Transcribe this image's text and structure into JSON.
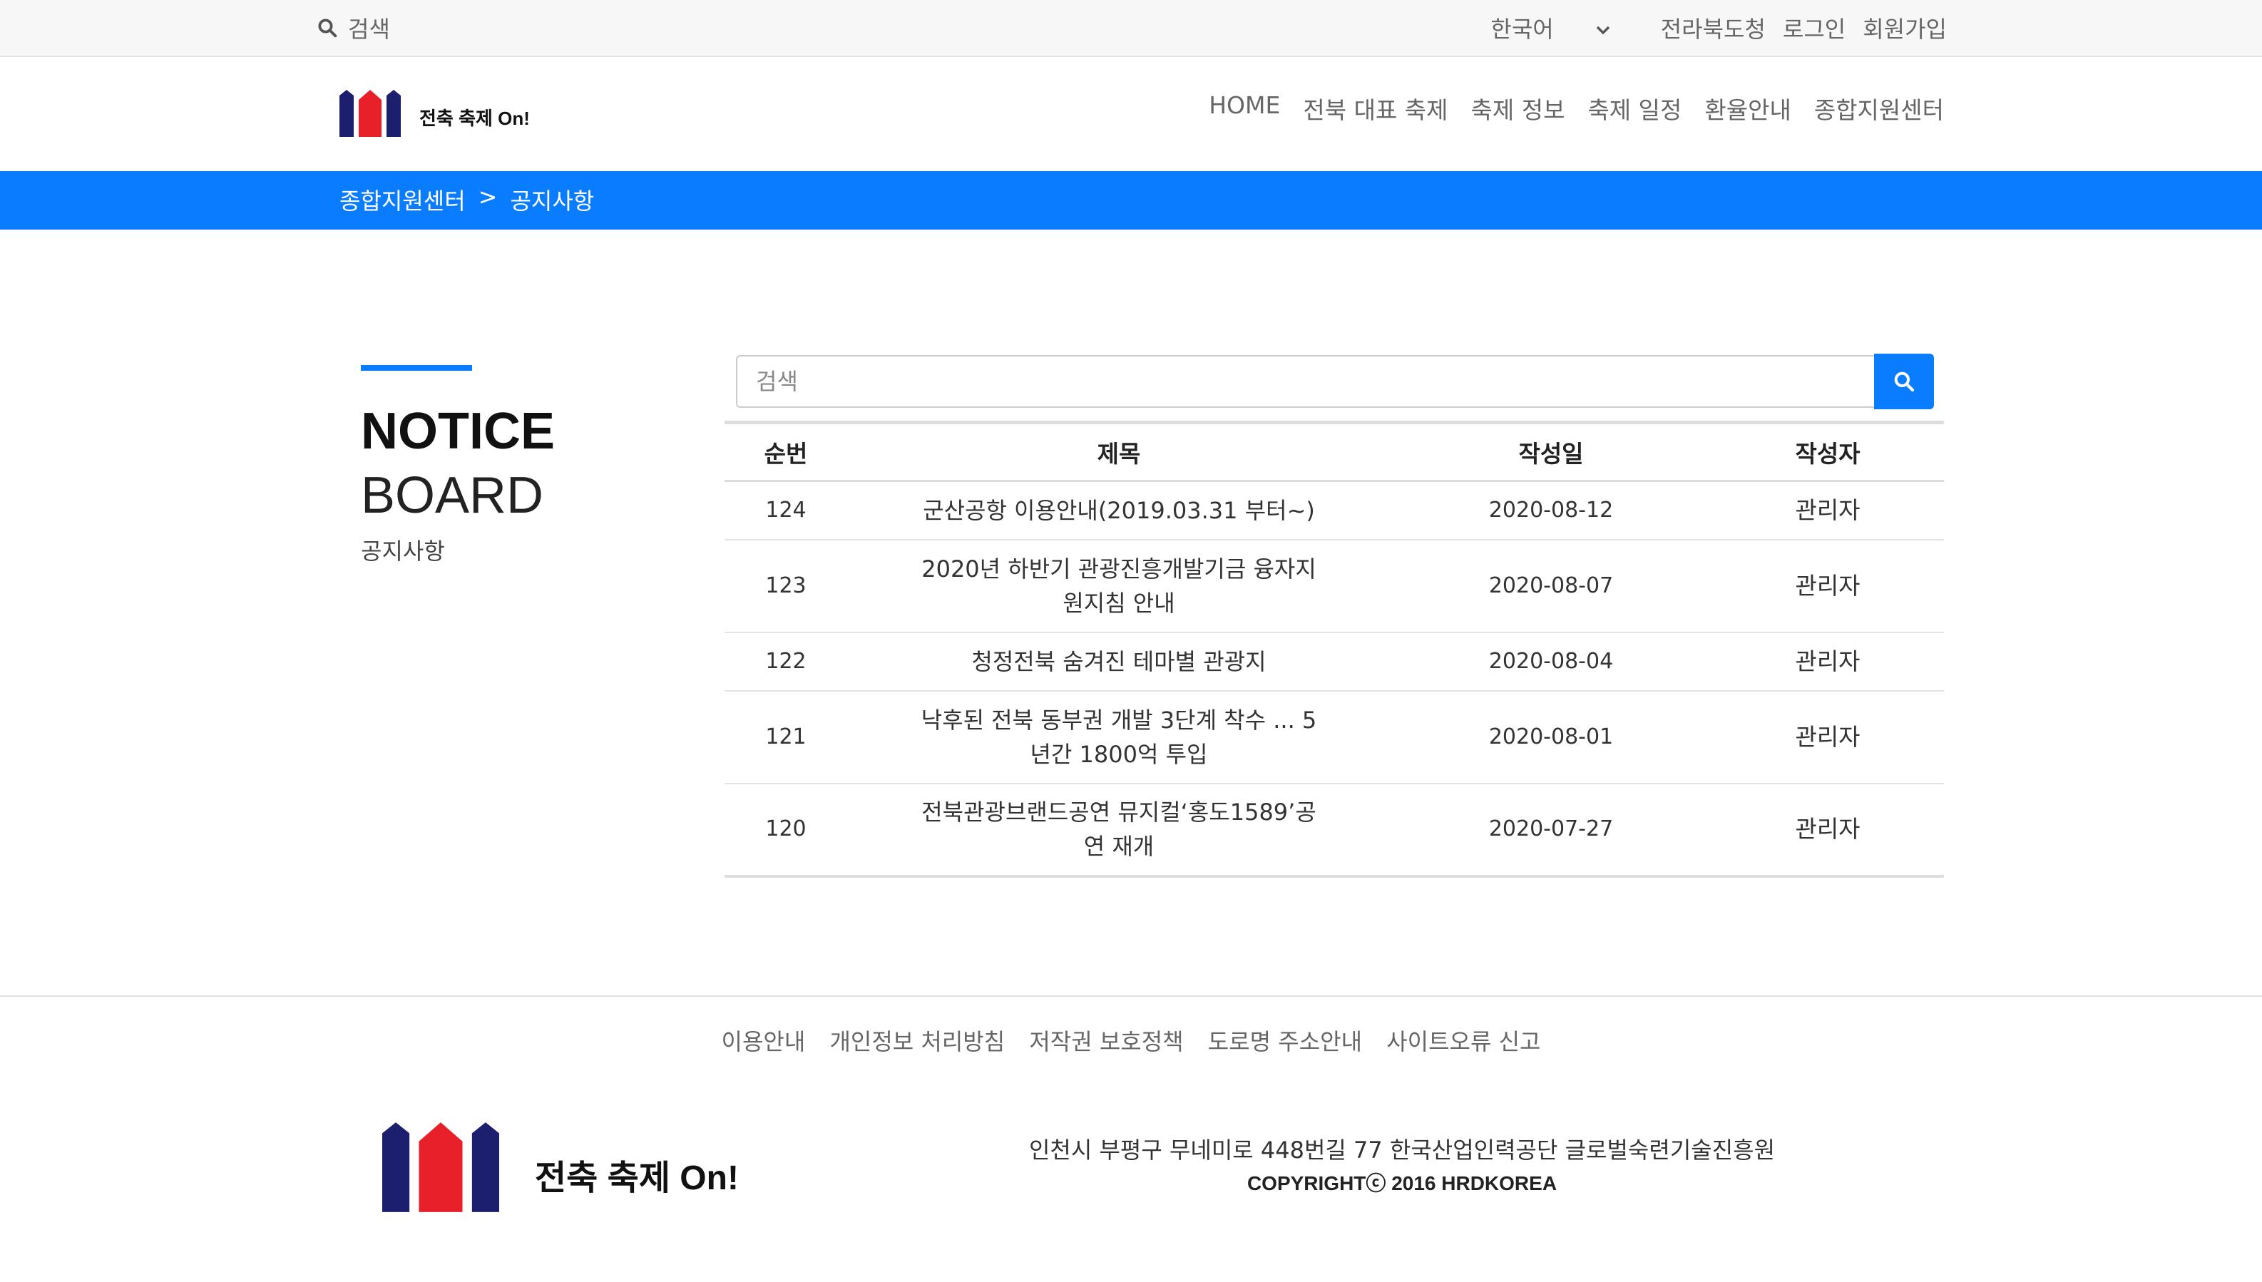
{
  "topbar": {
    "search_label": "검색",
    "language": "한국어",
    "links": [
      "전라북도청",
      "로그인",
      "회원가입"
    ]
  },
  "header": {
    "logo_text": "전축 축제 On!",
    "nav": [
      "HOME",
      "전북 대표 축제",
      "축제 정보",
      "축제 일정",
      "환율안내",
      "종합지원센터"
    ]
  },
  "breadcrumb": {
    "parent": "종합지원센터",
    "separator": ">",
    "current": "공지사항"
  },
  "side": {
    "title_bold": "NOTICE",
    "title_regular": "BOARD",
    "subtitle": "공지사항"
  },
  "board": {
    "search_placeholder": "검색",
    "columns": [
      "순번",
      "제목",
      "작성일",
      "작성자"
    ],
    "rows": [
      {
        "no": "124",
        "title": "군산공항 이용안내(2019.03.31 부터~)",
        "date": "2020-08-12",
        "author": "관리자"
      },
      {
        "no": "123",
        "title": "2020년 하반기 관광진흥개발기금 융자지원지침 안내",
        "date": "2020-08-07",
        "author": "관리자"
      },
      {
        "no": "122",
        "title": "청정전북 숨겨진 테마별 관광지",
        "date": "2020-08-04",
        "author": "관리자"
      },
      {
        "no": "121",
        "title": "낙후된 전북 동부권 개발 3단계 착수 ... 5년간 1800억 투입",
        "date": "2020-08-01",
        "author": "관리자"
      },
      {
        "no": "120",
        "title": "전북관광브랜드공연 뮤지컬‘홍도1589’공연 재개",
        "date": "2020-07-27",
        "author": "관리자"
      }
    ]
  },
  "footer": {
    "links": [
      "이용안내",
      "개인정보 처리방침",
      "저작권 보호정책",
      "도로명 주소안내",
      "사이트오류 신고"
    ],
    "logo_text": "전축 축제 On!",
    "address": "인천시 부평구 무네미로 448번길 77 한국산업인력공단 글로벌숙련기술진흥원",
    "copyright": "COPYRIGHTⓒ 2016 HRDKOREA"
  },
  "colors": {
    "accent": "#0a7cff",
    "logo_navy": "#1b1f6e",
    "logo_red": "#e8202a"
  }
}
